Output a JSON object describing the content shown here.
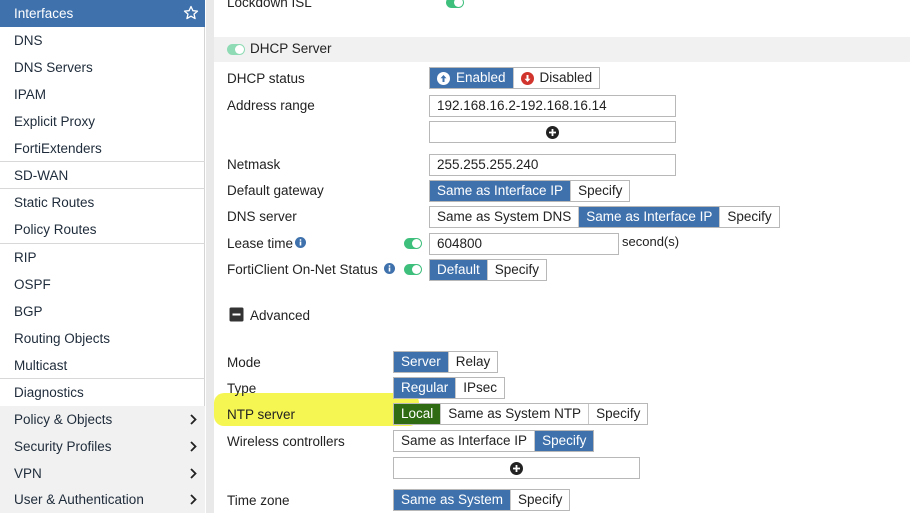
{
  "sidebar": {
    "items": [
      {
        "label": "Interfaces"
      },
      {
        "label": "DNS"
      },
      {
        "label": "DNS Servers"
      },
      {
        "label": "IPAM"
      },
      {
        "label": "Explicit Proxy"
      },
      {
        "label": "FortiExtenders"
      },
      {
        "label": "SD-WAN"
      },
      {
        "label": "Static Routes"
      },
      {
        "label": "Policy Routes"
      },
      {
        "label": "RIP"
      },
      {
        "label": "OSPF"
      },
      {
        "label": "BGP"
      },
      {
        "label": "Routing Objects"
      },
      {
        "label": "Multicast"
      },
      {
        "label": "Diagnostics"
      },
      {
        "label": "Policy & Objects"
      },
      {
        "label": "Security Profiles"
      },
      {
        "label": "VPN"
      },
      {
        "label": "User & Authentication"
      }
    ]
  },
  "form": {
    "lockdown_label": "Lockdown ISL",
    "dhcp_section_title": "DHCP Server",
    "dhcp_status": {
      "label": "DHCP status",
      "enabled": "Enabled",
      "disabled": "Disabled"
    },
    "address_range": {
      "label": "Address range",
      "value": "192.168.16.2-192.168.16.14"
    },
    "netmask": {
      "label": "Netmask",
      "value": "255.255.255.240"
    },
    "default_gateway": {
      "label": "Default gateway",
      "opt1": "Same as Interface IP",
      "opt2": "Specify"
    },
    "dns_server": {
      "label": "DNS server",
      "opt1": "Same as System DNS",
      "opt2": "Same as Interface IP",
      "opt3": "Specify"
    },
    "lease_time": {
      "label": "Lease time",
      "value": "604800",
      "unit": "second(s)"
    },
    "forticlient": {
      "label": "FortiClient On-Net Status",
      "opt1": "Default",
      "opt2": "Specify"
    },
    "advanced_label": "Advanced",
    "mode": {
      "label": "Mode",
      "opt1": "Server",
      "opt2": "Relay"
    },
    "type": {
      "label": "Type",
      "opt1": "Regular",
      "opt2": "IPsec"
    },
    "ntp_server": {
      "label": "NTP server",
      "opt1": "Local",
      "opt2": "Same as System NTP",
      "opt3": "Specify"
    },
    "wireless_controllers": {
      "label": "Wireless controllers",
      "opt1": "Same as Interface IP",
      "opt2": "Specify"
    },
    "time_zone": {
      "label": "Time zone",
      "opt1": "Same as System",
      "opt2": "Specify"
    }
  },
  "colors": {
    "accent": "#3f71ac",
    "selected_green": "#2e6b12",
    "toggle": "#3fbf7c",
    "highlight": "#f5f54a"
  }
}
